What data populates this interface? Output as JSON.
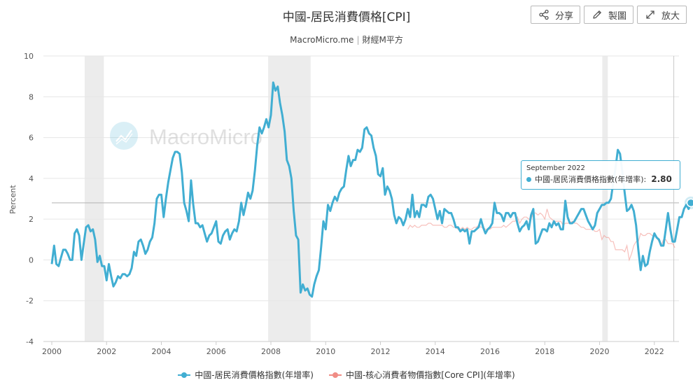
{
  "header": {
    "title": "中國-居民消費價格[CPI]",
    "source_site": "MacroMicro.me",
    "source_separator": "|",
    "source_name": "財經M平方"
  },
  "toolbar": {
    "share_label": "分享",
    "share_icon": "share-icon",
    "chart_label": "製圖",
    "chart_icon": "pencil-icon",
    "expand_label": "放大",
    "expand_icon": "expand-icon"
  },
  "watermark": {
    "text": "MacroMicro",
    "icon": "macromicro-logo-icon"
  },
  "colors": {
    "cpi": "#41aed2",
    "core_cpi": "#f08c85",
    "recession_band": "#ececec",
    "grid": "#e6e6e6",
    "reference_line": "#b3b3b3",
    "crosshair": "#c8c8c8"
  },
  "tooltip": {
    "date": "September 2022",
    "series": "中國-居民消費價格指數(年增率):",
    "value": "2.80"
  },
  "legend": [
    {
      "label": "中國-居民消費價格指數(年增率)",
      "color": "#41aed2"
    },
    {
      "label": "中國-核心消費者物價指數[Core CPI](年增率)",
      "color": "#f08c85"
    }
  ],
  "chart_data": {
    "type": "line",
    "ylabel": "Percent",
    "xlim": [
      2000,
      2022.9
    ],
    "ylim": [
      -4,
      10
    ],
    "yticks": [
      -4,
      -2,
      0,
      2,
      4,
      6,
      8,
      10
    ],
    "xticks": [
      2000,
      2002,
      2004,
      2006,
      2008,
      2010,
      2012,
      2014,
      2016,
      2018,
      2020,
      2022
    ],
    "grid": "horizontal",
    "legend_position": "bottom",
    "reference_line_y": 2.8,
    "crosshair_x": 2022.71,
    "shaded_periods": [
      [
        2001.2,
        2001.9
      ],
      [
        2007.9,
        2009.45
      ],
      [
        2020.1,
        2020.3
      ]
    ],
    "series": [
      {
        "name": "中國-居民消費價格指數(年增率)",
        "x_start": 2000.0,
        "x_step": 0.08333,
        "values": [
          -0.2,
          0.7,
          -0.2,
          -0.3,
          0.1,
          0.5,
          0.5,
          0.3,
          0.0,
          0.0,
          1.3,
          1.5,
          1.2,
          0.0,
          0.8,
          1.6,
          1.7,
          1.4,
          1.5,
          1.0,
          -0.1,
          0.2,
          -0.3,
          -0.3,
          -1.0,
          -0.2,
          -0.8,
          -1.3,
          -1.1,
          -0.8,
          -0.9,
          -0.7,
          -0.7,
          -0.8,
          -0.7,
          -0.4,
          0.4,
          0.2,
          0.9,
          1.0,
          0.7,
          0.3,
          0.5,
          0.9,
          1.1,
          1.8,
          3.0,
          3.2,
          3.2,
          2.1,
          3.0,
          3.8,
          4.4,
          5.0,
          5.3,
          5.3,
          5.2,
          4.3,
          2.8,
          2.4,
          1.9,
          3.9,
          2.7,
          1.8,
          1.8,
          1.6,
          1.7,
          1.3,
          0.9,
          1.2,
          1.3,
          1.6,
          1.9,
          0.9,
          0.8,
          1.2,
          1.4,
          1.5,
          1.0,
          1.3,
          1.5,
          1.4,
          1.9,
          2.8,
          2.2,
          2.7,
          3.3,
          3.0,
          3.4,
          4.4,
          5.6,
          6.5,
          6.2,
          6.5,
          6.9,
          6.5,
          7.1,
          8.7,
          8.3,
          8.5,
          7.7,
          7.1,
          6.3,
          4.9,
          4.6,
          4.0,
          2.4,
          1.2,
          1.0,
          -1.6,
          -1.2,
          -1.5,
          -1.4,
          -1.7,
          -1.8,
          -1.2,
          -0.8,
          -0.5,
          0.6,
          1.9,
          1.5,
          2.7,
          2.4,
          2.8,
          3.1,
          2.9,
          3.3,
          3.5,
          3.6,
          4.4,
          5.1,
          4.6,
          4.9,
          4.9,
          5.4,
          5.3,
          5.5,
          6.4,
          6.5,
          6.2,
          6.1,
          5.5,
          5.1,
          4.2,
          4.1,
          4.5,
          3.2,
          3.6,
          3.4,
          3.0,
          2.2,
          1.8,
          2.1,
          2.0,
          1.7,
          2.0,
          2.5,
          2.1,
          3.2,
          2.1,
          2.4,
          2.1,
          2.7,
          2.7,
          2.6,
          3.1,
          3.2,
          3.0,
          2.5,
          2.0,
          2.4,
          1.8,
          2.5,
          2.4,
          2.3,
          2.3,
          2.0,
          1.6,
          1.6,
          1.4,
          1.5,
          1.4,
          1.5,
          0.8,
          1.4,
          1.4,
          1.5,
          1.6,
          2.0,
          1.6,
          1.3,
          1.5,
          1.6,
          1.8,
          2.8,
          2.3,
          2.3,
          2.2,
          1.9,
          2.3,
          2.3,
          2.1,
          2.3,
          2.3,
          1.8,
          1.4,
          1.6,
          1.7,
          1.9,
          1.5,
          2.2,
          2.5,
          0.8,
          0.9,
          1.2,
          1.5,
          1.5,
          1.4,
          1.8,
          1.6,
          1.9,
          1.7,
          1.8,
          1.5,
          1.5,
          2.9,
          2.1,
          1.8,
          1.8,
          1.9,
          2.1,
          2.3,
          2.5,
          2.5,
          2.2,
          1.9,
          1.7,
          1.5,
          1.7,
          2.3,
          2.5,
          2.7,
          2.7,
          2.8,
          2.8,
          3.0,
          3.8,
          4.5,
          5.4,
          5.2,
          4.3,
          3.3,
          2.4,
          2.5,
          2.7,
          2.4,
          1.7,
          0.5,
          -0.5,
          0.2,
          -0.3,
          -0.2,
          0.4,
          0.9,
          1.3,
          1.1,
          1.0,
          0.7,
          0.7,
          1.5,
          2.3,
          1.5,
          0.9,
          0.9,
          1.5,
          2.1,
          2.1,
          2.5,
          2.7,
          2.5,
          2.8
        ]
      },
      {
        "name": "中國-核心消費者物價指數[Core CPI](年增率)",
        "x_start": 2013.0,
        "x_step": 0.08333,
        "values": [
          1.5,
          1.7,
          1.6,
          1.7,
          1.6,
          1.6,
          1.7,
          1.7,
          1.7,
          1.8,
          1.8,
          1.7,
          1.7,
          1.7,
          1.7,
          1.7,
          1.6,
          1.6,
          1.7,
          1.7,
          1.6,
          1.6,
          1.5,
          1.5,
          1.6,
          1.5,
          1.6,
          1.5,
          1.5,
          1.6,
          1.6,
          1.7,
          1.6,
          1.6,
          1.5,
          1.5,
          1.5,
          1.6,
          1.6,
          1.6,
          1.6,
          1.6,
          1.7,
          1.6,
          1.7,
          1.8,
          1.9,
          1.9,
          2.1,
          1.8,
          2.0,
          2.1,
          2.1,
          2.0,
          2.0,
          2.3,
          2.3,
          2.2,
          2.3,
          2.2,
          2.0,
          2.5,
          2.1,
          2.0,
          1.9,
          1.9,
          1.9,
          1.9,
          1.7,
          1.8,
          1.8,
          1.8,
          1.9,
          1.8,
          1.8,
          1.7,
          1.6,
          1.6,
          1.5,
          1.5,
          1.5,
          1.5,
          1.4,
          1.4,
          1.5,
          1.0,
          1.2,
          1.1,
          1.1,
          0.9,
          0.9,
          0.5,
          0.5,
          0.5,
          0.5,
          0.4,
          0.7,
          0.0,
          0.3,
          0.7,
          0.9,
          0.9,
          1.3,
          1.2,
          1.2,
          1.3,
          1.3,
          1.2,
          1.2,
          1.1,
          0.9,
          0.7,
          1.0,
          1.0,
          0.8,
          0.8,
          0.8,
          0.6
        ]
      }
    ]
  }
}
